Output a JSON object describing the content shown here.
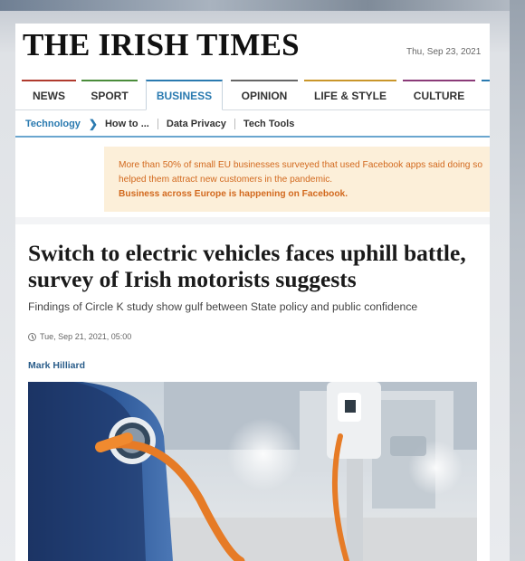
{
  "masthead": {
    "logo": "THE IRISH TIMES",
    "date": "Thu, Sep 23, 2021"
  },
  "nav": {
    "tabs": [
      {
        "label": "NEWS",
        "active": false
      },
      {
        "label": "SPORT",
        "active": false
      },
      {
        "label": "BUSINESS",
        "active": true
      },
      {
        "label": "OPINION",
        "active": false
      },
      {
        "label": "LIFE & STYLE",
        "active": false
      },
      {
        "label": "CULTURE",
        "active": false
      }
    ]
  },
  "subnav": {
    "items": [
      "Technology",
      "How to ...",
      "Data Privacy",
      "Tech Tools"
    ],
    "chevron": "❯"
  },
  "ad": {
    "text": "More than 50% of small EU businesses surveyed that used Facebook apps said doing so helped them attract new customers in the pandemic.",
    "cta": "Business across Europe is happening on Facebook."
  },
  "article": {
    "headline": "Switch to electric vehicles faces uphill battle, survey of Irish motorists suggests",
    "standfirst": "Findings of Circle K study show gulf between State policy and public confidence",
    "timestamp": "Tue, Sep 21, 2021, 05:00",
    "author": "Mark Hilliard"
  },
  "colors": {
    "accent": "#2a7ab0",
    "ad_text": "#d2691e",
    "ad_bg": "#fcefd9"
  },
  "icons": {
    "timestamp": "clock-icon",
    "subnav_separator": "chevron-right-icon"
  }
}
